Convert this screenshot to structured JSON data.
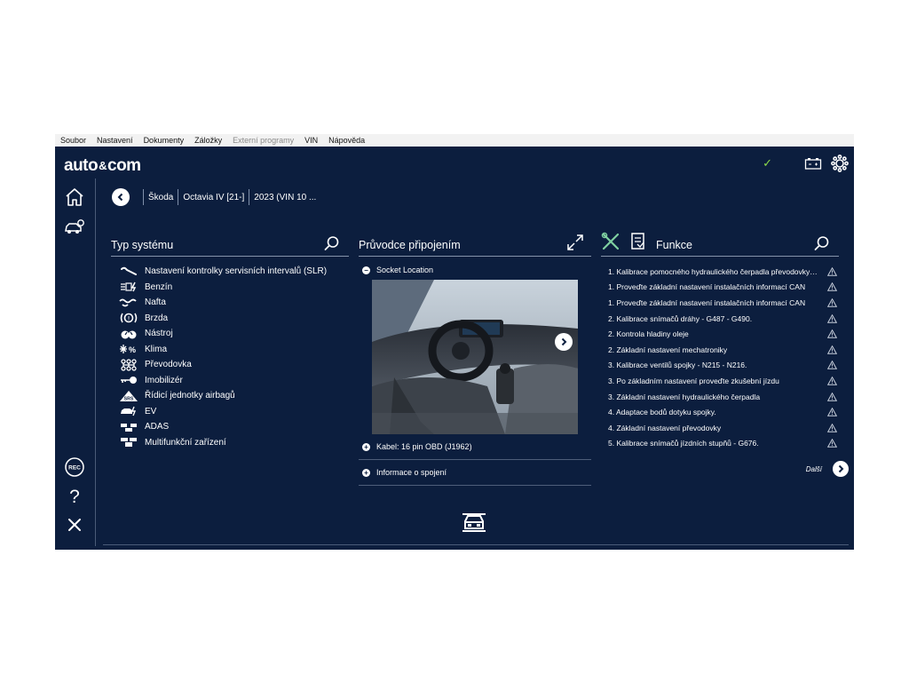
{
  "menu": [
    "Soubor",
    "Nastavení",
    "Dokumenty",
    "Záložky",
    "Externí programy",
    "VIN",
    "Nápověda"
  ],
  "menu_disabled": [
    "Externí programy"
  ],
  "logo": {
    "left": "auto",
    "mid": "&",
    "right": "com"
  },
  "status": {
    "check": "✓"
  },
  "breadcrumb": {
    "brand": "Škoda",
    "model": "Octavia IV [21-]",
    "year": "2023 (VIN 10 ..."
  },
  "systems_panel": {
    "title": "Typ systému",
    "items": [
      {
        "label": "Nastavení kontrolky servisních intervalů (SLR)",
        "icon": "wrench-icon"
      },
      {
        "label": "Benzín",
        "icon": "petrol-icon"
      },
      {
        "label": "Nafta",
        "icon": "diesel-icon"
      },
      {
        "label": "Brzda",
        "icon": "brake-icon"
      },
      {
        "label": "Nástroj",
        "icon": "instrument-icon"
      },
      {
        "label": "Klima",
        "icon": "climate-icon"
      },
      {
        "label": "Převodovka",
        "icon": "gearbox-icon"
      },
      {
        "label": "Imobilizér",
        "icon": "key-icon"
      },
      {
        "label": "Řídicí jednotky airbagů",
        "icon": "srs-icon"
      },
      {
        "label": "EV",
        "icon": "ev-icon"
      },
      {
        "label": "ADAS",
        "icon": "adas-icon"
      },
      {
        "label": "Multifunkční zařízení",
        "icon": "multifunction-icon"
      }
    ]
  },
  "connection_panel": {
    "title": "Průvodce připojením",
    "socket_location": "Socket Location",
    "cable": "Kabel: 16 pin OBD (J1962)",
    "connection_info": "Informace o spojení"
  },
  "functions_panel": {
    "title": "Funkce",
    "items": [
      "1. Kalibrace pomocného hydraulického čerpadla převodovky - V...",
      "1. Proveďte základní nastavení instalačních informací CAN",
      "1. Proveďte základní nastavení instalačních informací CAN",
      "2. Kalibrace snímačů dráhy - G487 - G490.",
      "2. Kontrola hladiny oleje",
      "2. Základní nastavení mechatroniky",
      "3. Kalibrace ventilů spojky - N215 - N216.",
      "3. Po základním nastavení proveďte zkušební jízdu",
      "3. Základní nastavení hydraulického čerpadla",
      "4. Adaptace bodů dotyku spojky.",
      "4. Základní nastavení převodovky",
      "5. Kalibrace snímačů jízdních stupňů - G676."
    ],
    "more_label": "Další"
  },
  "colors": {
    "background": "#0c1e3e",
    "accent_check": "#8bd84a",
    "divider": "#8593ab"
  }
}
